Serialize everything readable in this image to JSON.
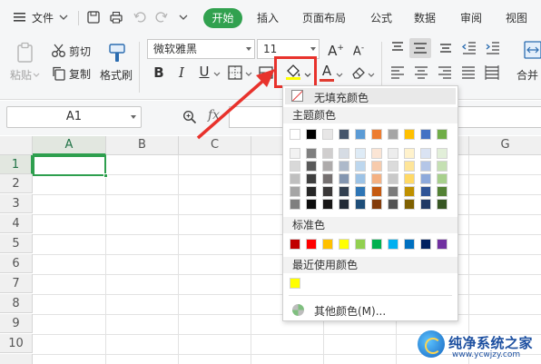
{
  "menubar": {
    "file_label": "文件",
    "tabs": [
      "开始",
      "插入",
      "页面布局",
      "公式",
      "数据",
      "审阅",
      "视图"
    ]
  },
  "ribbon": {
    "paste_label": "粘贴",
    "cut_label": "剪切",
    "copy_label": "复制",
    "format_painter_label": "格式刷",
    "font_name": "微软雅黑",
    "font_size": "11",
    "bold": "B",
    "italic": "I",
    "underline": "U",
    "font_color_letter": "A",
    "merge_label": "合并"
  },
  "formula_bar": {
    "cell_ref": "A1",
    "fx_label": "fx"
  },
  "grid": {
    "columns": [
      "A",
      "B",
      "C",
      "D",
      "E",
      "F",
      "G"
    ],
    "rows": [
      "1",
      "2",
      "3",
      "4",
      "5",
      "6",
      "7",
      "8",
      "9",
      "10"
    ],
    "active_cell": "A1"
  },
  "dropdown": {
    "no_fill_label": "无填充颜色",
    "theme_colors_title": "主题颜色",
    "standard_colors_title": "标准色",
    "recent_colors_title": "最近使用颜色",
    "more_colors_label": "其他颜色(M)...",
    "theme_top_row": [
      "#ffffff",
      "#000000",
      "#e7e6e6",
      "#44546a",
      "#5b9bd5",
      "#ed7d31",
      "#a5a5a5",
      "#ffc000",
      "#4472c4",
      "#70ad47"
    ],
    "theme_shades": [
      [
        "#f2f2f2",
        "#7f7f7f",
        "#d0cece",
        "#d6dce4",
        "#deebf6",
        "#fbe5d5",
        "#ededed",
        "#fff2cc",
        "#dae3f3",
        "#e2efd9"
      ],
      [
        "#d8d8d8",
        "#595959",
        "#aeabab",
        "#adb9ca",
        "#bdd7ee",
        "#f7cbac",
        "#dbdbdb",
        "#fee599",
        "#b4c6e7",
        "#c5e0b3"
      ],
      [
        "#bfbfbf",
        "#3f3f3f",
        "#757070",
        "#8496b0",
        "#9dc3e6",
        "#f4b183",
        "#c9c9c9",
        "#ffd966",
        "#8eaadb",
        "#a8d08d"
      ],
      [
        "#a5a5a5",
        "#262626",
        "#3a3838",
        "#323f4f",
        "#2e75b5",
        "#c55a11",
        "#7b7b7b",
        "#bf9000",
        "#2f5496",
        "#538135"
      ],
      [
        "#7f7f7f",
        "#0c0c0c",
        "#171616",
        "#222a35",
        "#1e4e79",
        "#833c0b",
        "#525252",
        "#7f6000",
        "#1f3864",
        "#375623"
      ]
    ],
    "standard_colors": [
      "#c00000",
      "#ff0000",
      "#ffc000",
      "#ffff00",
      "#92d050",
      "#00b050",
      "#00b0f0",
      "#0070c0",
      "#002060",
      "#7030a0"
    ],
    "recent_colors": [
      "#ffff00"
    ]
  },
  "watermark": {
    "title": "纯净系统之家",
    "url": "www.ycwjzy.com"
  }
}
